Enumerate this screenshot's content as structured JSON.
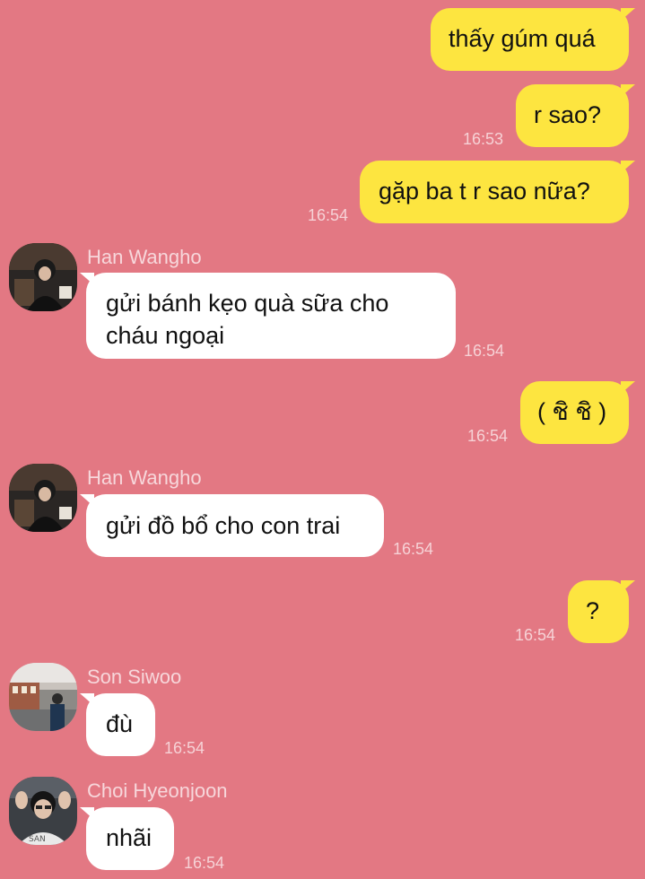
{
  "messages": [
    {
      "id": "m1",
      "sender": "me",
      "text": "thấy gúm quá",
      "time": ""
    },
    {
      "id": "m2",
      "sender": "me",
      "text": "r sao?",
      "time": "16:53"
    },
    {
      "id": "m3",
      "sender": "me",
      "text": "gặp ba t r sao nữa?",
      "time": "16:54"
    },
    {
      "id": "m4",
      "sender": "Han Wangho",
      "text_line1": "gửi bánh kẹo quà sữa cho",
      "text_line2": "cháu ngoại",
      "time": "16:54"
    },
    {
      "id": "m5",
      "sender": "me",
      "text": "( ชิ ชิ )",
      "time": "16:54"
    },
    {
      "id": "m6",
      "sender": "Han Wangho",
      "text": "gửi đồ bổ cho con trai",
      "time": "16:54"
    },
    {
      "id": "m7",
      "sender": "me",
      "text": "?",
      "time": "16:54"
    },
    {
      "id": "m8",
      "sender": "Son Siwoo",
      "text": "đù",
      "time": "16:54"
    },
    {
      "id": "m9",
      "sender": "Choi Hyeonjoon",
      "text": "nhãi",
      "time": "16:54"
    }
  ],
  "names": {
    "han1": "Han Wangho",
    "han2": "Han Wangho",
    "son": "Son Siwoo",
    "choi": "Choi Hyeonjoon"
  },
  "colors": {
    "background": "#e37883",
    "my_bubble": "#fde540",
    "their_bubble": "#ffffff"
  }
}
